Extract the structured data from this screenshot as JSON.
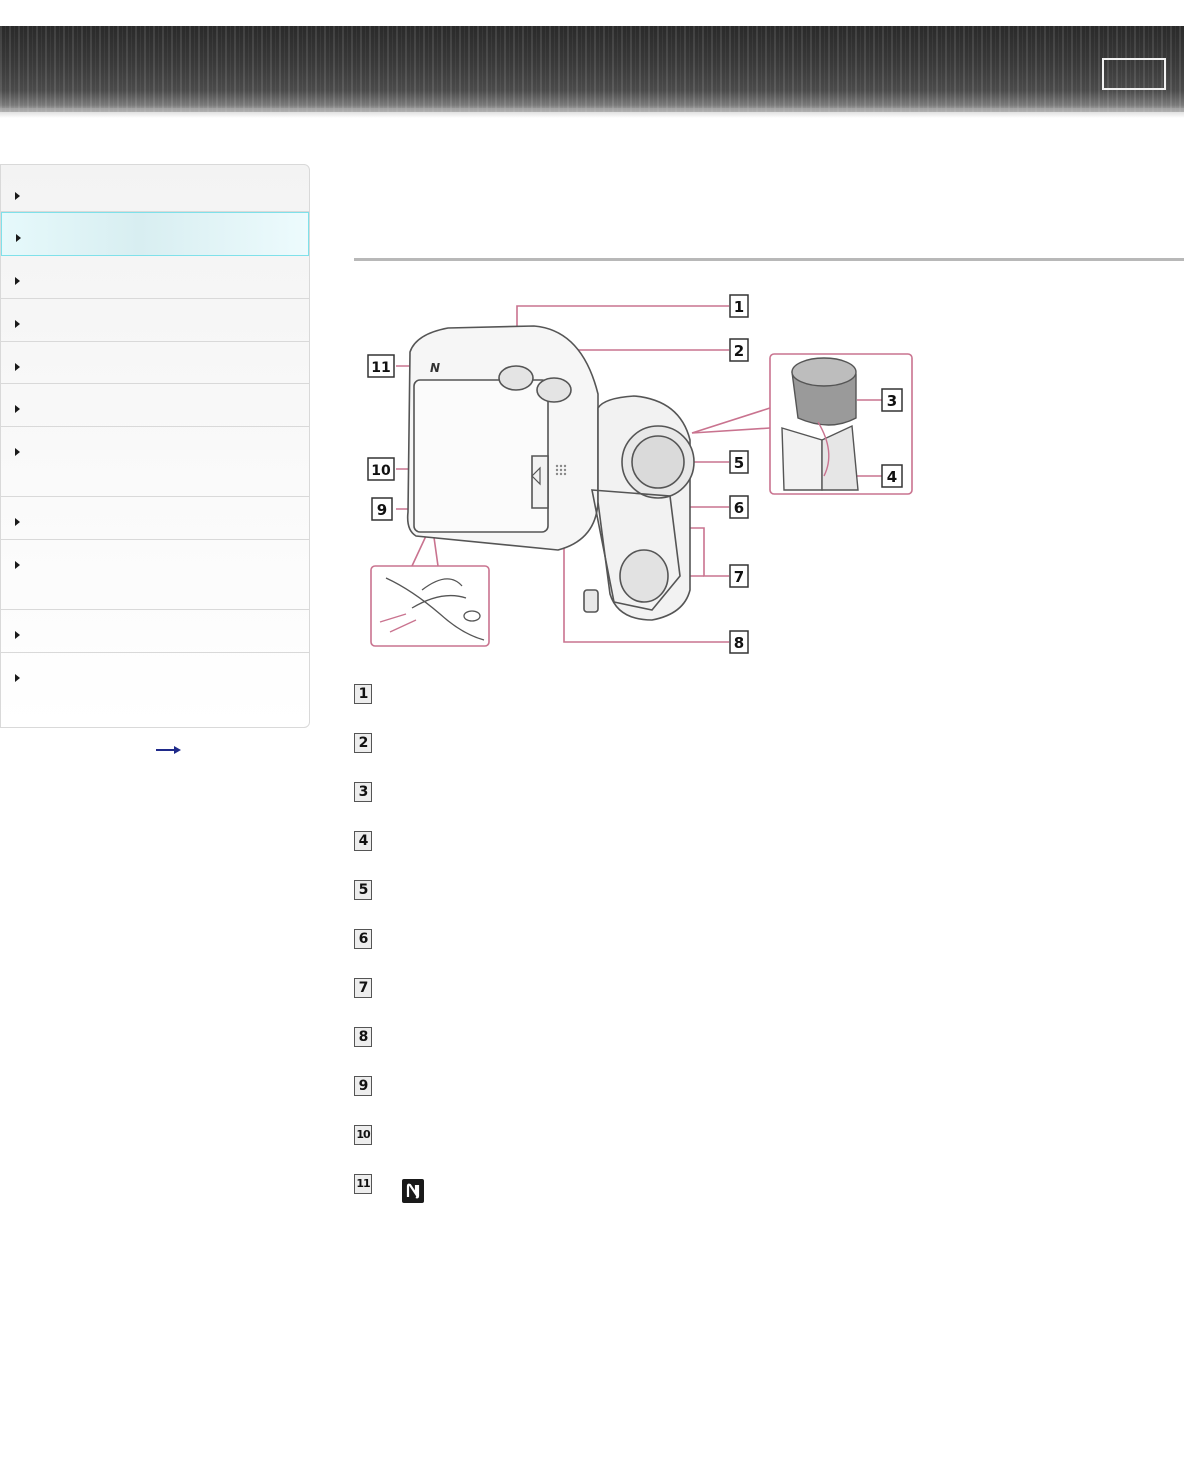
{
  "header": {
    "box_label": ""
  },
  "sidebar": {
    "items": [
      {
        "label": ""
      },
      {
        "label": "",
        "active": true
      },
      {
        "label": ""
      },
      {
        "label": ""
      },
      {
        "label": ""
      },
      {
        "label": ""
      },
      {
        "label": ""
      },
      {
        "label": ""
      },
      {
        "label": ""
      },
      {
        "label": ""
      },
      {
        "label": ""
      }
    ],
    "more_label": ""
  },
  "main": {
    "title": ""
  },
  "diagram": {
    "callouts": [
      "1",
      "2",
      "3",
      "4",
      "5",
      "6",
      "7",
      "8",
      "9",
      "10",
      "11"
    ],
    "line_color": "#c9738f"
  },
  "parts": [
    {
      "number": "1",
      "name": ""
    },
    {
      "number": "2",
      "name": ""
    },
    {
      "number": "3",
      "name": ""
    },
    {
      "number": "4",
      "name": ""
    },
    {
      "number": "5",
      "name": ""
    },
    {
      "number": "6",
      "name": ""
    },
    {
      "number": "7",
      "name": ""
    },
    {
      "number": "8",
      "name": ""
    },
    {
      "number": "9",
      "name": ""
    },
    {
      "number": "10",
      "name": ""
    },
    {
      "number": "11",
      "name": "",
      "icon": "nfc-n-mark-icon"
    }
  ]
}
